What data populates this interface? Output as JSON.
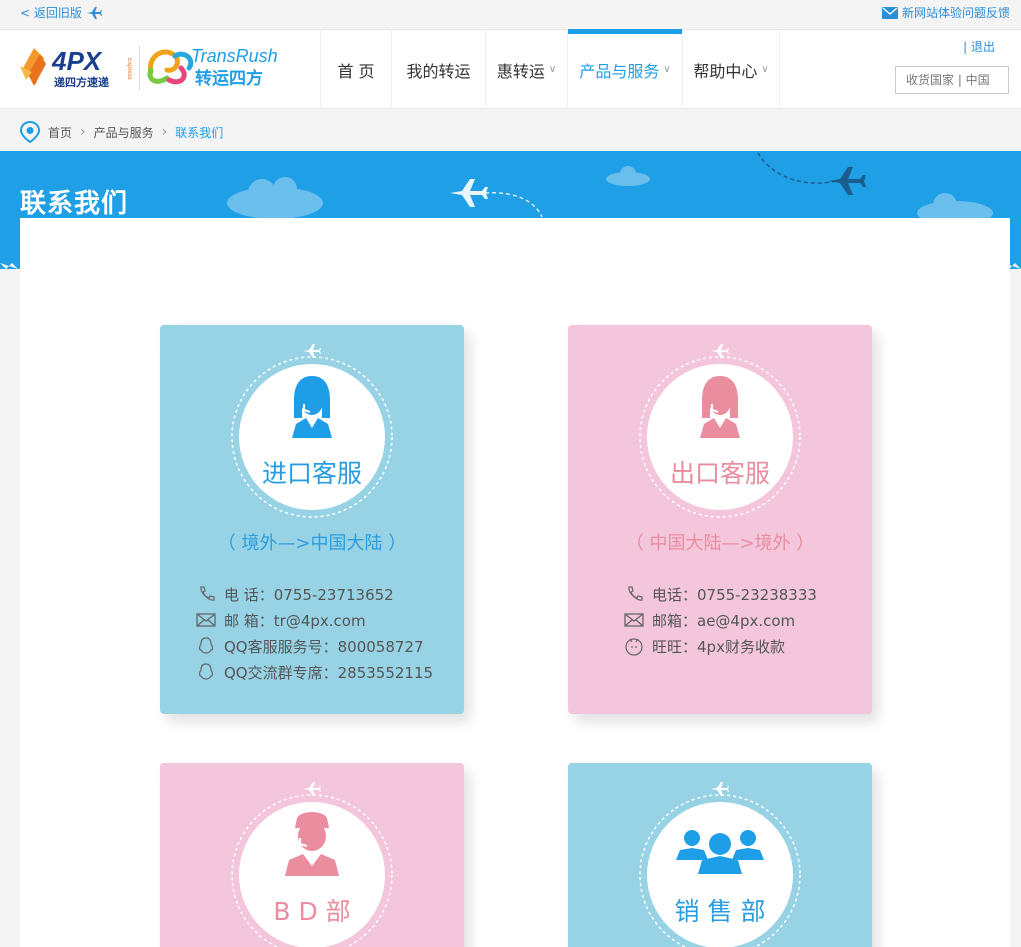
{
  "topbar": {
    "back_label": "< 返回旧版",
    "feedback_label": "新网站体验问题反馈"
  },
  "header": {
    "logo_4px_text": "4PX",
    "logo_4px_sub": "递四方速递",
    "logo_4px_express": "Express",
    "logo_tr_text": "TransRush",
    "logo_tr_sub": "转运四方",
    "nav": [
      {
        "label": "首 页"
      },
      {
        "label": "我的转运"
      },
      {
        "label": "惠转运"
      },
      {
        "label": "产品与服务"
      },
      {
        "label": "帮助中心"
      }
    ],
    "logout_label": "| 退出",
    "country_select": "收货国家 | 中国"
  },
  "breadcrumb": {
    "items": [
      "首页",
      "产品与服务"
    ],
    "current": "联系我们"
  },
  "banner": {
    "title": "联系我们"
  },
  "cards": [
    {
      "title": "进口客服",
      "direction": "（ 境外—>中国大陆 ）",
      "contacts": [
        {
          "icon": "phone-icon",
          "text": "电 话：0755-23713652"
        },
        {
          "icon": "mail-icon",
          "text": "邮 箱：tr@4px.com"
        },
        {
          "icon": "qq-icon",
          "text": "QQ客服服务号：800058727"
        },
        {
          "icon": "qq-icon",
          "text": "QQ交流群专席：2853552115"
        }
      ]
    },
    {
      "title": "出口客服",
      "direction": "（ 中国大陆—>境外 ）",
      "contacts": [
        {
          "icon": "phone-icon",
          "text": "电话：0755-23238333"
        },
        {
          "icon": "mail-icon",
          "text": "邮箱：ae@4px.com"
        },
        {
          "icon": "wangwang-icon",
          "text": "旺旺：4px财务收款"
        }
      ]
    },
    {
      "title": "B D 部"
    },
    {
      "title": "销 售 部"
    }
  ],
  "colors": {
    "accent": "#1f9ee8",
    "card_blue": "#97d3e5",
    "card_pink": "#f3c6dc",
    "text_blue": "#2a9de0",
    "text_pink": "#ea8d9f"
  }
}
